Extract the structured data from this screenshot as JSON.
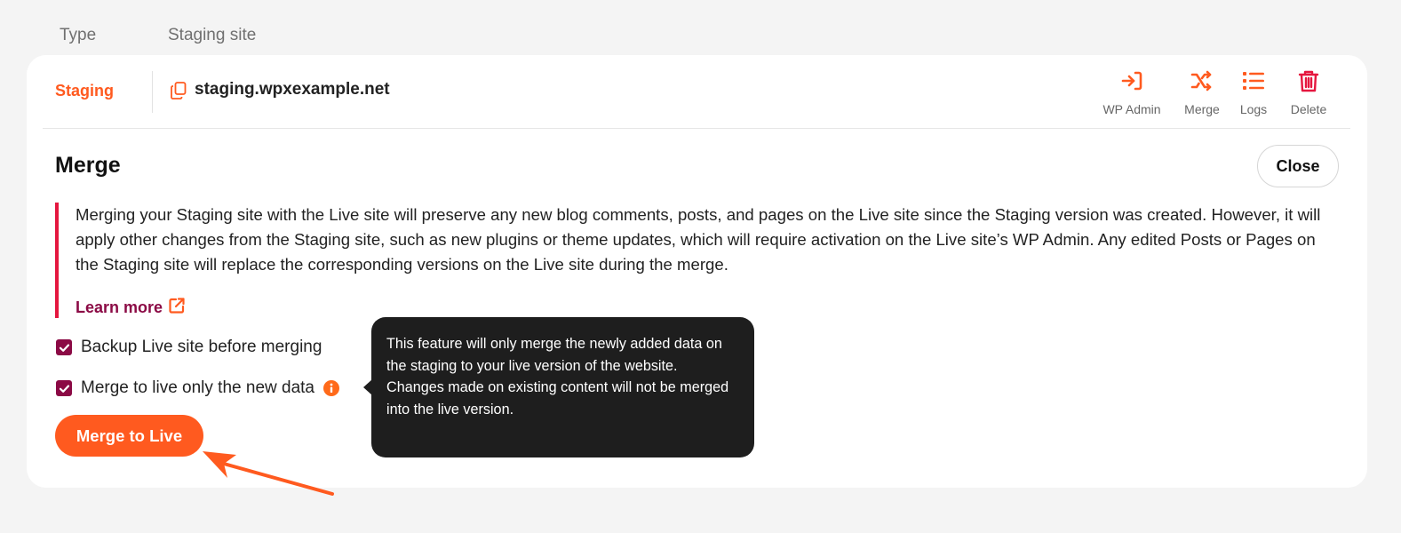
{
  "columns": {
    "type": "Type",
    "site": "Staging site"
  },
  "row": {
    "type_label": "Staging",
    "site_url": "staging.wpxexample.net",
    "actions": {
      "wp_admin": "WP Admin",
      "merge": "Merge",
      "logs": "Logs",
      "delete": "Delete"
    }
  },
  "merge_panel": {
    "title": "Merge",
    "close_label": "Close",
    "notice": "Merging your Staging site with the Live site will preserve any new blog comments, posts, and pages on the Live site since the Staging version was created. However, it will apply other changes from the Staging site, such as new plugins or theme updates, which will require activation on the Live site’s WP Admin. Any edited Posts or Pages on the Staging site will replace the corresponding versions on the Live site during the merge.",
    "learn_more": "Learn more",
    "options": {
      "backup_label": "Backup Live site before merging",
      "backup_checked": true,
      "new_data_label": "Merge to live only the new data",
      "new_data_checked": true
    },
    "submit_label": "Merge to Live",
    "tooltip_line1": "This feature will only merge the newly added data on the staging to your live version of the website.",
    "tooltip_line2": "Changes made on existing content will not be merged into the live version."
  },
  "colors": {
    "accent": "#ff5a1f",
    "brand": "#8b0a45",
    "danger": "#e5173f",
    "tooltip_bg": "#1e1e1e"
  },
  "icons": [
    "copy-icon",
    "sign-in-icon",
    "shuffle-icon",
    "list-icon",
    "trash-icon",
    "external-link-icon",
    "check-icon",
    "info-icon",
    "pointer-arrow"
  ]
}
